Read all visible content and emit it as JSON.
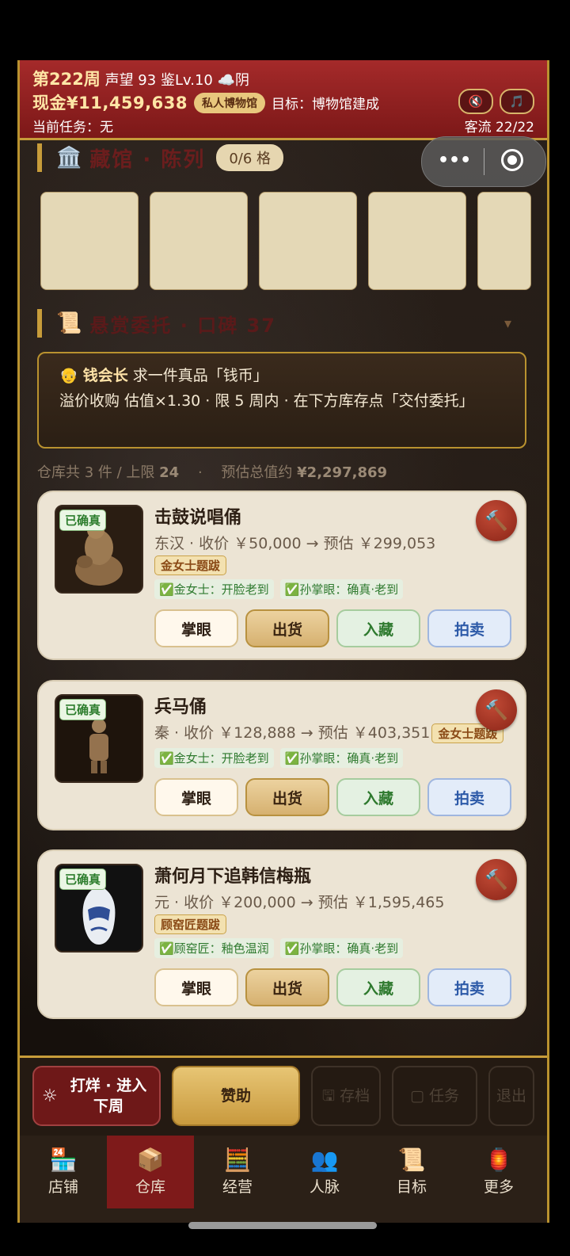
{
  "header": {
    "week": "第222周",
    "reputation": "声望 93",
    "level": "鉴Lv.10",
    "weather": "☁️阴",
    "cash": "现金¥11,459,638",
    "museum_pill": "私人博物馆",
    "goal": "目标：博物馆建成",
    "mute_icon": "🔇",
    "music_icon": "🎵",
    "task": "当前任务：无",
    "traffic": "客流 22/22"
  },
  "gallery": {
    "icon": "🏛️",
    "title": "藏馆 · 陈列",
    "capacity": "0/6 格"
  },
  "bounty_section": {
    "icon": "📜",
    "title": "悬赏委托 · 口碑 37",
    "toggle": "▾"
  },
  "bounty": {
    "avatar": "👴",
    "requester": "钱会长",
    "request": "求一件真品「钱币」",
    "terms": "溢价收购 估值×1.30  ·  限 5 周内  ·  在下方库存点「交付委托」"
  },
  "summary": {
    "count": "仓库共 3 件 / 上限",
    "limit": "24",
    "sep": "·",
    "value_label": "预估总值约",
    "value": "¥2,297,869"
  },
  "items": [
    {
      "tag": "已确真",
      "name": "击鼓说唱俑",
      "meta": "东汉 · 收价 ￥50,000 → 预估 ￥299,053",
      "seal": "金女士题跋",
      "check1": "✅金女士：开脸老到",
      "check2": "✅孙掌眼：确真·老到",
      "buttons": [
        "掌眼",
        "出货",
        "入藏",
        "拍卖"
      ],
      "hammer": "🔨"
    },
    {
      "tag": "已确真",
      "name": "兵马俑",
      "meta": "秦 · 收价 ￥128,888 → 预估 ￥403,351",
      "seal": "金女士题跋",
      "check1": "✅金女士：开脸老到",
      "check2": "✅孙掌眼：确真·老到",
      "buttons": [
        "掌眼",
        "出货",
        "入藏",
        "拍卖"
      ],
      "hammer": "🔨"
    },
    {
      "tag": "已确真",
      "name": "萧何月下追韩信梅瓶",
      "meta": "元 · 收价 ￥200,000 → 预估 ￥1,595,465",
      "seal": "顾窑匠题跋",
      "check1": "✅顾窑匠：釉色温润",
      "check2": "✅孙掌眼：确真·老到",
      "buttons": [
        "掌眼",
        "出货",
        "入藏",
        "拍卖"
      ],
      "hammer": "🔨"
    }
  ],
  "actions": {
    "next_week_icon": "☼",
    "next_week": "打烊 · 进入下周",
    "sponsor": "赞助",
    "save": "存档",
    "tasks": "任务",
    "exit": "退出"
  },
  "tabs": [
    {
      "icon": "🏪",
      "label": "店铺"
    },
    {
      "icon": "📦",
      "label": "仓库"
    },
    {
      "icon": "🧮",
      "label": "经营"
    },
    {
      "icon": "👥",
      "label": "人脉"
    },
    {
      "icon": "📜",
      "label": "目标"
    },
    {
      "icon": "🏮",
      "label": "更多"
    }
  ],
  "colors": {
    "header_red": "#a52a2a",
    "gold": "#c79c3a",
    "active_tab": "#7e1a1a",
    "card_bg": "#ece4d4"
  }
}
